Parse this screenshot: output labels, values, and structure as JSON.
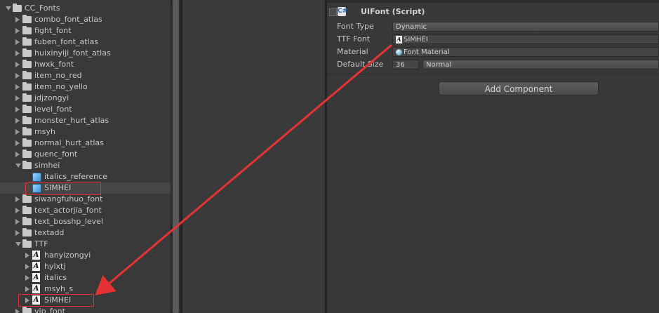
{
  "project": {
    "rows": [
      {
        "label": "CC_Fonts",
        "type": "folder",
        "depth": 0,
        "open": true
      },
      {
        "label": "combo_font_atlas",
        "type": "folder",
        "depth": 1,
        "open": false
      },
      {
        "label": "fight_font",
        "type": "folder",
        "depth": 1,
        "open": false
      },
      {
        "label": "fuben_font_atlas",
        "type": "folder",
        "depth": 1,
        "open": false
      },
      {
        "label": "huixinyiji_font_atlas",
        "type": "folder",
        "depth": 1,
        "open": false
      },
      {
        "label": "hwxk_font",
        "type": "folder",
        "depth": 1,
        "open": false
      },
      {
        "label": "item_no_red",
        "type": "folder",
        "depth": 1,
        "open": false
      },
      {
        "label": "item_no_yello",
        "type": "folder",
        "depth": 1,
        "open": false
      },
      {
        "label": "jdjzongyi",
        "type": "folder",
        "depth": 1,
        "open": false
      },
      {
        "label": "level_font",
        "type": "folder",
        "depth": 1,
        "open": false
      },
      {
        "label": "monster_hurt_atlas",
        "type": "folder",
        "depth": 1,
        "open": false
      },
      {
        "label": "msyh",
        "type": "folder",
        "depth": 1,
        "open": false
      },
      {
        "label": "normal_hurt_atlas",
        "type": "folder",
        "depth": 1,
        "open": false
      },
      {
        "label": "quenc_font",
        "type": "folder",
        "depth": 1,
        "open": false
      },
      {
        "label": "simhei",
        "type": "folder",
        "depth": 1,
        "open": true
      },
      {
        "label": "italics_reference",
        "type": "prefab",
        "depth": 2,
        "open": null
      },
      {
        "label": "SIMHEI",
        "type": "prefab",
        "depth": 2,
        "open": null,
        "selected": true
      },
      {
        "label": "siwangfuhuo_font",
        "type": "folder",
        "depth": 1,
        "open": false
      },
      {
        "label": "text_actorjia_font",
        "type": "folder",
        "depth": 1,
        "open": false
      },
      {
        "label": "text_bosshp_level",
        "type": "folder",
        "depth": 1,
        "open": false
      },
      {
        "label": "textadd",
        "type": "folder",
        "depth": 1,
        "open": false
      },
      {
        "label": "TTF",
        "type": "folder",
        "depth": 1,
        "open": true
      },
      {
        "label": "hanyizongyi",
        "type": "font",
        "depth": 2,
        "open": false
      },
      {
        "label": "hylxtj",
        "type": "font",
        "depth": 2,
        "open": false
      },
      {
        "label": "italics",
        "type": "font",
        "depth": 2,
        "open": false
      },
      {
        "label": "msyh_s",
        "type": "font",
        "depth": 2,
        "open": false
      },
      {
        "label": "SIMHEI",
        "type": "font",
        "depth": 2,
        "open": false
      },
      {
        "label": "vip_font",
        "type": "folder",
        "depth": 1,
        "open": false
      }
    ]
  },
  "inspector": {
    "component_title": "UIFont (Script)",
    "props": {
      "font_type_label": "Font Type",
      "font_type_value": "Dynamic",
      "ttf_font_label": "TTF Font",
      "ttf_font_value": "SIMHEI",
      "material_label": "Material",
      "material_value": "Font Material",
      "default_size_label": "Default Size",
      "default_size_value": "36",
      "style_value": "Normal"
    },
    "add_component_label": "Add Component"
  },
  "annotation_color": "#e53333"
}
